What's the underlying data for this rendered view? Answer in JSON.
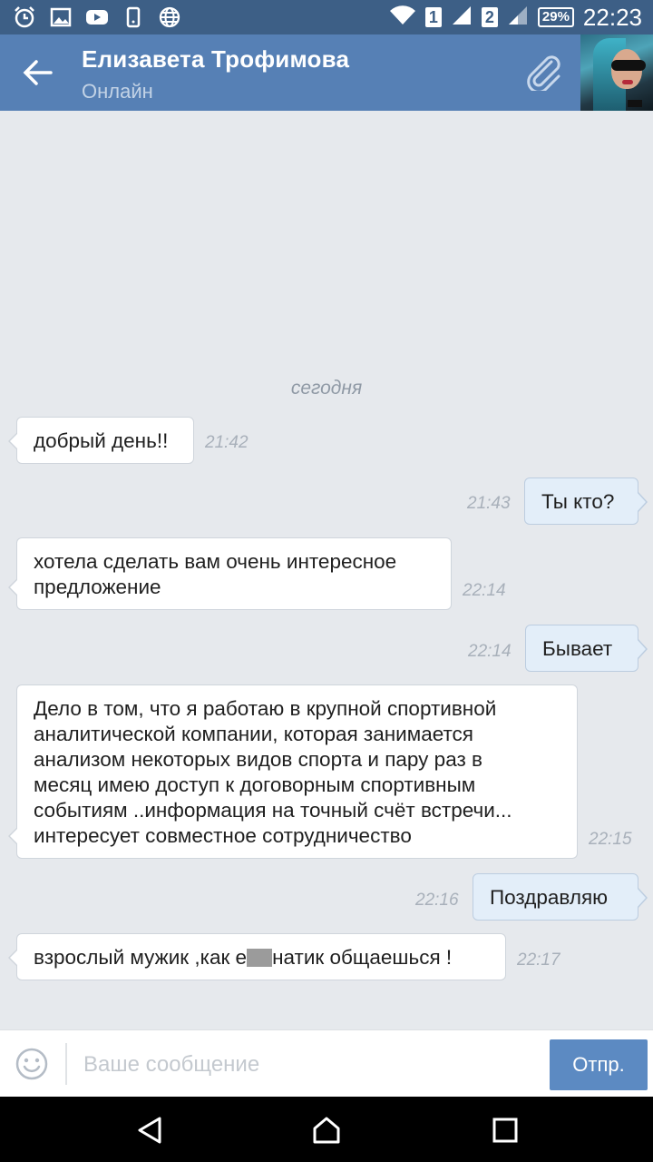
{
  "status_bar": {
    "sim1": "1",
    "sim2": "2",
    "battery": "29%",
    "time": "22:23"
  },
  "header": {
    "title": "Елизавета Трофимова",
    "subtitle": "Онлайн"
  },
  "chat": {
    "date_label": "сегодня",
    "messages": [
      {
        "dir": "in",
        "text": "добрый день!!",
        "time": "21:42"
      },
      {
        "dir": "out",
        "text": "Ты кто?",
        "time": "21:43"
      },
      {
        "dir": "in",
        "line1": "хотела сделать вам очень интересное",
        "line2": "предложение",
        "time": "22:14"
      },
      {
        "dir": "out",
        "text": "Бывает",
        "time": "22:14"
      },
      {
        "dir": "in",
        "lines": [
          "Дело в том, что я работаю в крупной спортивной",
          "аналитической компании, которая занимается",
          "анализом некоторых видов спорта и пару раз в",
          "месяц имею доступ к договорным спортивным",
          "событиям ..информация на точный счёт встречи...",
          "интересует совместное сотрудничество"
        ],
        "time": "22:15"
      },
      {
        "dir": "out",
        "text": "Поздравляю",
        "time": "22:16"
      },
      {
        "dir": "in",
        "text_before": "взрослый мужик ,как е",
        "text_after": "натик общаешься !",
        "time": "22:17"
      }
    ]
  },
  "composer": {
    "placeholder": "Ваше сообщение",
    "send_label": "Отпр."
  }
}
